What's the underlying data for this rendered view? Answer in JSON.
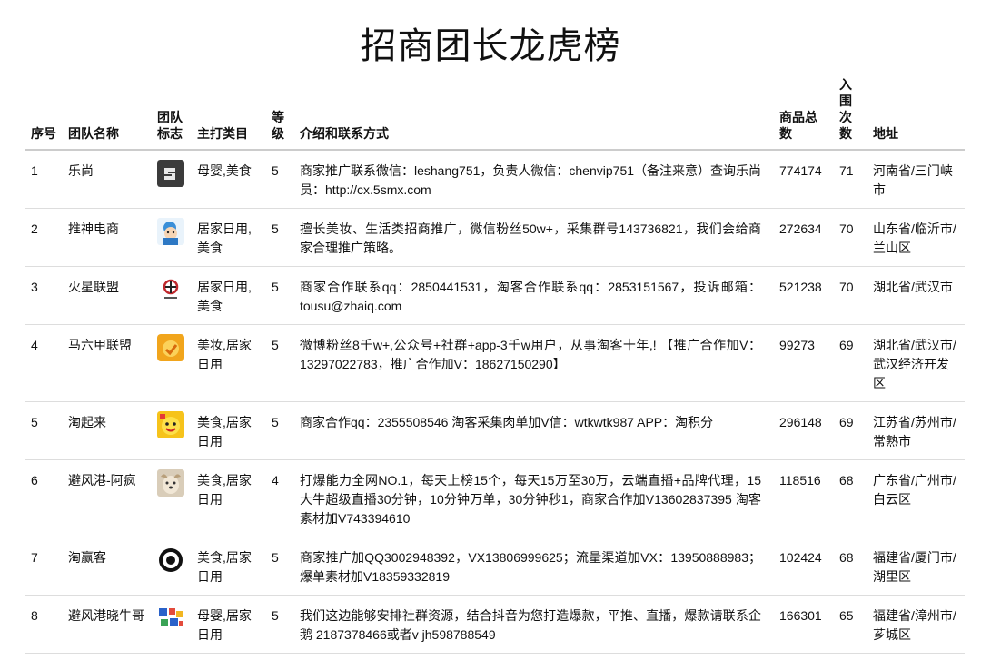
{
  "title": "招商团长龙虎榜",
  "headers": [
    "序号",
    "团队名称",
    "团队标志",
    "主打类目",
    "等级",
    "介绍和联系方式",
    "商品总数",
    "入围次数",
    "地址"
  ],
  "rows": [
    {
      "no": "1",
      "name": "乐尚",
      "logo": "leshang-logo-icon",
      "category": "母婴,美食",
      "level": "5",
      "intro": "商家推广联系微信：leshang751，负责人微信：chenvip751（备注来意）查询乐尚员：http://cx.5smx.com",
      "count": "774174",
      "times": "71",
      "addr": "河南省/三门峡市"
    },
    {
      "no": "2",
      "name": "推神电商",
      "logo": "tuishen-logo-icon",
      "category": "居家日用,美食",
      "level": "5",
      "intro": "擅长美妆、生活类招商推广，微信粉丝50w+，采集群号143736821，我们会给商家合理推广策略。",
      "count": "272634",
      "times": "70",
      "addr": "山东省/临沂市/兰山区"
    },
    {
      "no": "3",
      "name": "火星联盟",
      "logo": "huoxing-logo-icon",
      "category": "居家日用,美食",
      "level": "5",
      "intro": "商家合作联系qq：2850441531，淘客合作联系qq：2853151567，投诉邮箱：tousu@zhaiq.com",
      "count": "521238",
      "times": "70",
      "addr": "湖北省/武汉市"
    },
    {
      "no": "4",
      "name": "马六甲联盟",
      "logo": "maliujia-logo-icon",
      "category": "美妆,居家日用",
      "level": "5",
      "intro": "微博粉丝8千w+,公众号+社群+app-3千w用户，从事淘客十年,! 【推广合作加V：13297022783，推广合作加V：18627150290】",
      "count": "99273",
      "times": "69",
      "addr": "湖北省/武汉市/武汉经济开发区"
    },
    {
      "no": "5",
      "name": "淘起来",
      "logo": "taoqilai-logo-icon",
      "category": "美食,居家日用",
      "level": "5",
      "intro": "商家合作qq：2355508546 淘客采集肉单加V信：wtkwtk987 APP：淘积分",
      "count": "296148",
      "times": "69",
      "addr": "江苏省/苏州市/常熟市"
    },
    {
      "no": "6",
      "name": "避风港-阿疯",
      "logo": "bifenggang-logo-icon",
      "category": "美食,居家日用",
      "level": "4",
      "intro": "打爆能力全网NO.1，每天上榜15个，每天15万至30万，云端直播+品牌代理，15大牛超级直播30分钟，10分钟万单，30分钟秒1，商家合作加V13602837395 淘客素材加V743394610",
      "count": "118516",
      "times": "68",
      "addr": "广东省/广州市/白云区"
    },
    {
      "no": "7",
      "name": "淘赢客",
      "logo": "taoyingke-logo-icon",
      "category": "美食,居家日用",
      "level": "5",
      "intro": "商家推广加QQ3002948392，VX13806999625；流量渠道加VX：13950888983；爆单素材加V18359332819",
      "count": "102424",
      "times": "68",
      "addr": "福建省/厦门市/湖里区"
    },
    {
      "no": "8",
      "name": "避风港晓牛哥",
      "logo": "xiaoniuge-logo-icon",
      "category": "母婴,居家日用",
      "level": "5",
      "intro": "我们这边能够安排社群资源，结合抖音为您打造爆款，平推、直播，爆款请联系企鹅 2187378466或者v jh598788549",
      "count": "166301",
      "times": "65",
      "addr": "福建省/漳州市/芗城区"
    }
  ]
}
